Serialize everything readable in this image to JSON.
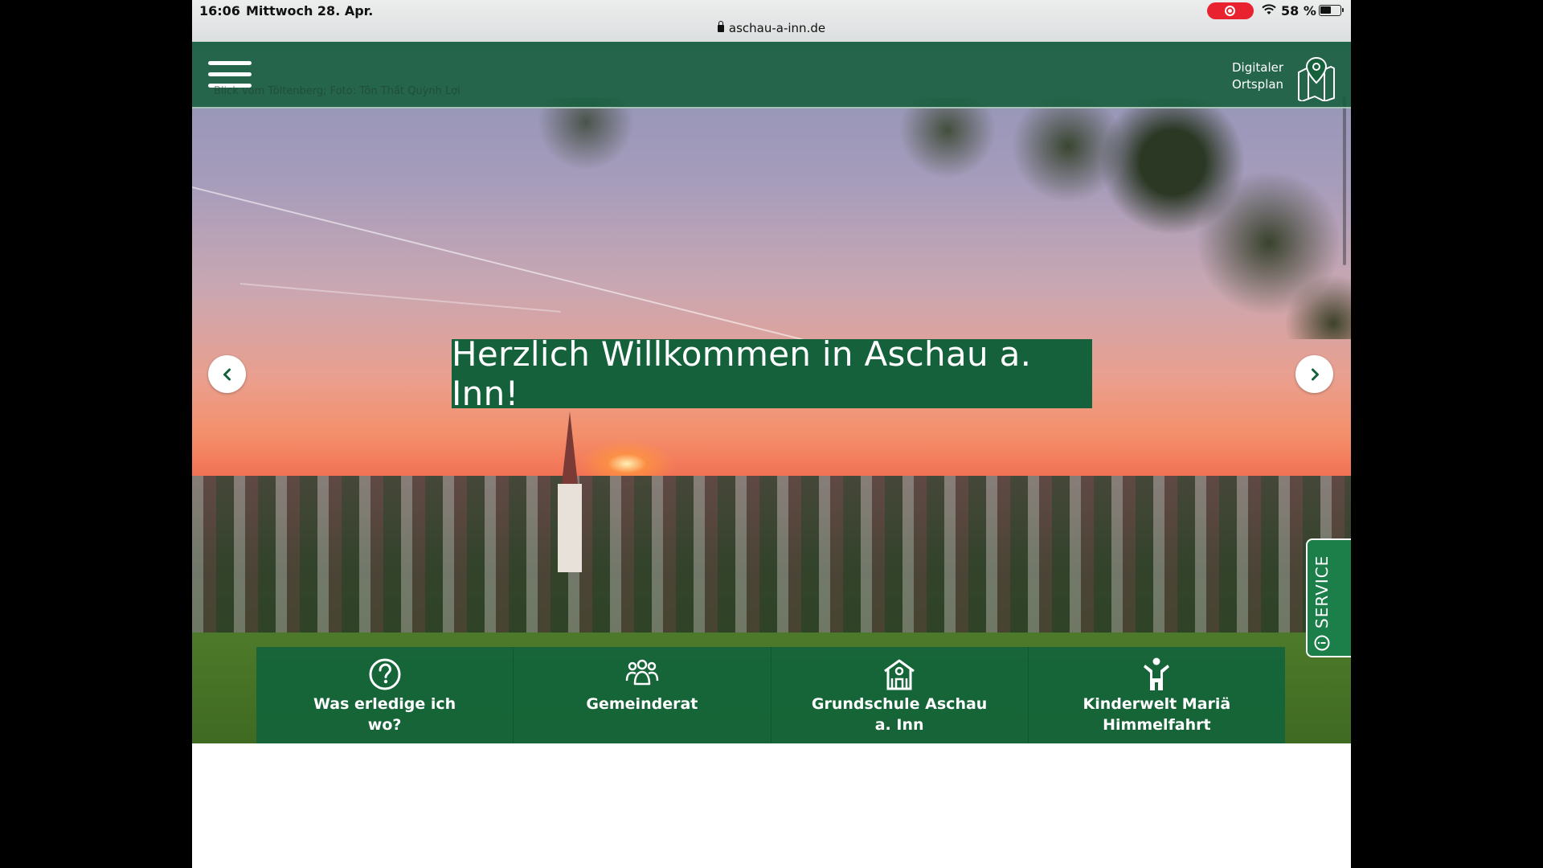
{
  "status_bar": {
    "time": "16:06",
    "date": "Mittwoch 28. Apr.",
    "url": "aschau-a-inn.de",
    "battery_percent": "58 %",
    "battery_level": 0.58
  },
  "header": {
    "photo_credit": "Blick vom Töltenberg; Foto: Tôn Thất Quỳnh Lợi",
    "map_link_label": "Digitaler Ortsplan"
  },
  "hero": {
    "welcome": "Herzlich Willkommen in Aschau a. Inn!"
  },
  "service_tab": {
    "label": "SERVICE"
  },
  "quick_links": [
    {
      "label": "Was erledige ich wo?",
      "icon": "question-circle-icon"
    },
    {
      "label": "Gemeinderat",
      "icon": "group-icon"
    },
    {
      "label": "Grundschule Aschau a. Inn",
      "icon": "school-icon"
    },
    {
      "label": "Kinderwelt Mariä Himmelfahrt",
      "icon": "child-icon"
    }
  ],
  "colors": {
    "brand_green": "#14613c",
    "service_green": "#1c7f4a",
    "record_red": "#e8232f"
  }
}
